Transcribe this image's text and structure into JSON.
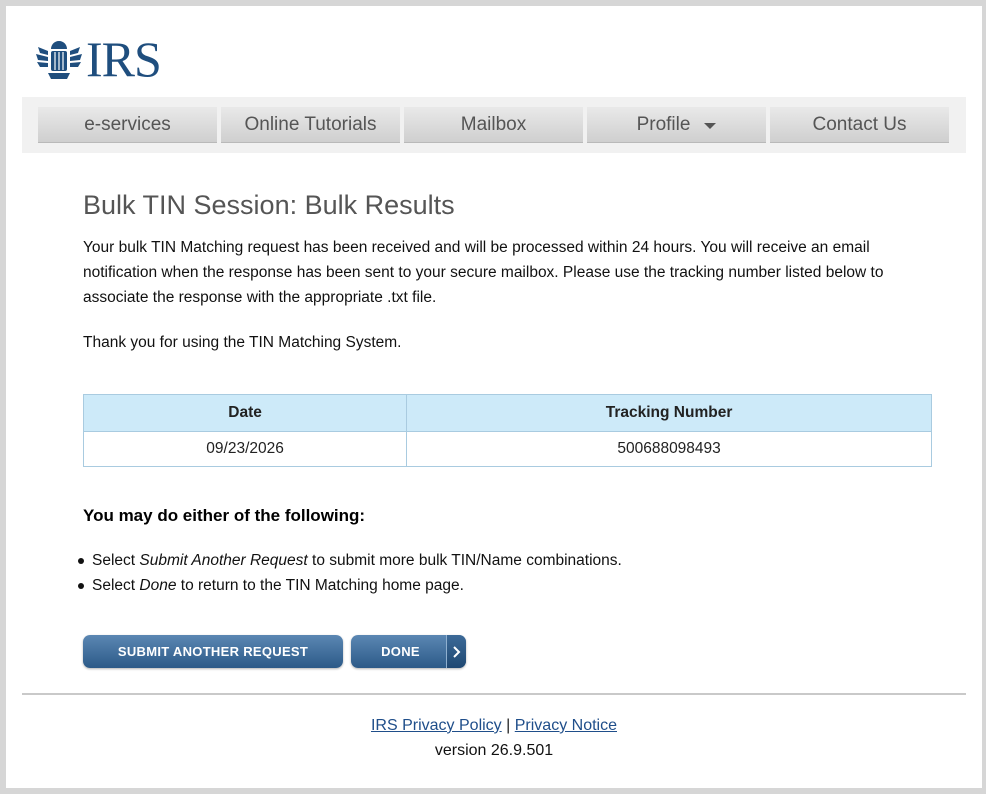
{
  "logo": {
    "text": "IRS",
    "emblem": "eagle-emblem-icon",
    "color": "#1f4e7e"
  },
  "nav": {
    "items": [
      {
        "label": "e-services"
      },
      {
        "label": "Online Tutorials"
      },
      {
        "label": "Mailbox"
      },
      {
        "label": "Profile",
        "has_dropdown": true
      },
      {
        "label": "Contact Us"
      }
    ]
  },
  "main": {
    "title": "Bulk TIN Session: Bulk Results",
    "message": "Your bulk TIN Matching request has been received and will be processed within 24 hours. You will receive an email notification when the response has been sent to your secure mailbox. Please use the tracking number listed below to associate the response with the appropriate .txt file.",
    "thanks": "Thank you for using the TIN Matching System."
  },
  "results_table": {
    "headers": [
      "Date",
      "Tracking Number"
    ],
    "rows": [
      [
        "09/23/2026",
        "500688098493"
      ]
    ],
    "header_bg": "#cdeaf9"
  },
  "options": {
    "heading": "You may do either of the following:",
    "items": [
      {
        "prefix": "Select ",
        "emphasis": "Submit Another Request",
        "suffix": " to submit more bulk TIN/Name combinations."
      },
      {
        "prefix": "Select ",
        "emphasis": "Done",
        "suffix": " to return to the TIN Matching home page."
      }
    ]
  },
  "buttons": {
    "submit_label": "SUBMIT ANOTHER REQUEST",
    "done_label": "DONE",
    "color": "#2c5a88"
  },
  "footer": {
    "privacy_policy": "IRS Privacy Policy",
    "separator": "|",
    "privacy_notice": "Privacy Notice",
    "version": "version 26.9.501"
  }
}
